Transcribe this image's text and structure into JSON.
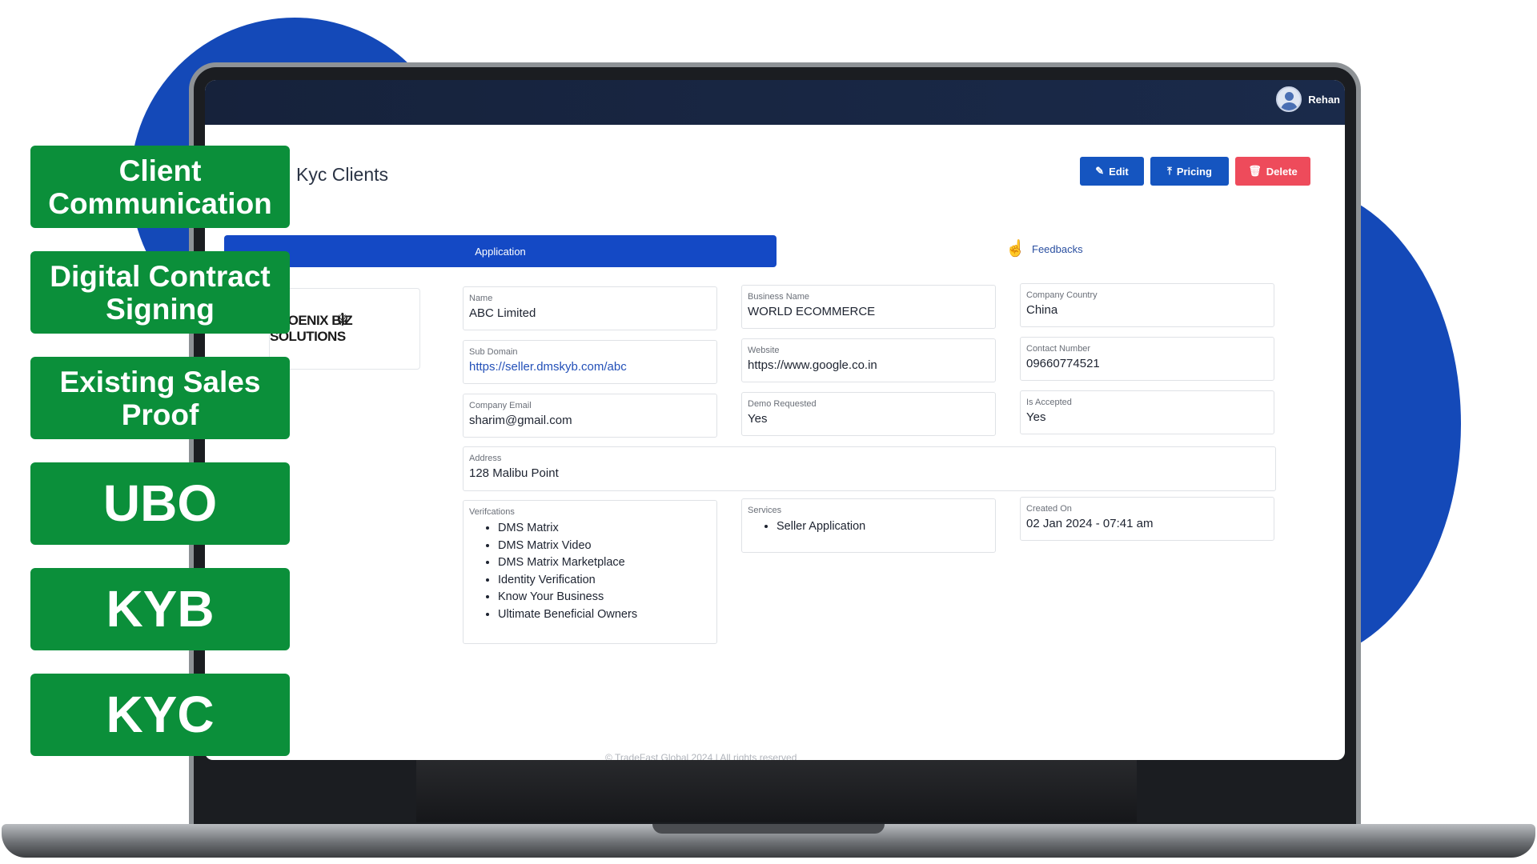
{
  "header": {
    "user_name": "Rehan"
  },
  "page": {
    "title": "Kyc Clients",
    "buttons": {
      "edit": "Edit",
      "pricing": "Pricing",
      "delete": "Delete"
    },
    "tabs": {
      "application": "Application",
      "feedbacks": "Feedbacks"
    },
    "logo_text": "PHOENIX BIZ SOLUTIONS"
  },
  "fields": {
    "name": {
      "label": "Name",
      "value": "ABC Limited"
    },
    "business_name": {
      "label": "Business Name",
      "value": "WORLD ECOMMERCE"
    },
    "company_country": {
      "label": "Company Country",
      "value": "China"
    },
    "sub_domain": {
      "label": "Sub Domain",
      "value": "https://seller.dmskyb.com/abc"
    },
    "website": {
      "label": "Website",
      "value": "https://www.google.co.in"
    },
    "contact_number": {
      "label": "Contact Number",
      "value": "09660774521"
    },
    "company_email": {
      "label": "Company Email",
      "value": "sharim@gmail.com"
    },
    "demo_requested": {
      "label": "Demo Requested",
      "value": "Yes"
    },
    "is_accepted": {
      "label": "Is Accepted",
      "value": "Yes"
    },
    "address": {
      "label": "Address",
      "value": "128 Malibu Point"
    },
    "verifications": {
      "label": "Verifcations",
      "items": [
        "DMS Matrix",
        "DMS Matrix Video",
        "DMS Matrix Marketplace",
        "Identity Verification",
        "Know Your Business",
        "Ultimate Beneficial Owners"
      ]
    },
    "services": {
      "label": "Services",
      "items": [
        "Seller Application"
      ]
    },
    "created_on": {
      "label": "Created On",
      "value": "02 Jan 2024 - 07:41 am"
    }
  },
  "footer": "© TradeFast Global 2024 | All rights reserved",
  "badges": [
    "Client Communication",
    "Digital Contract Signing",
    "Existing Sales Proof",
    "UBO",
    "KYB",
    "KYC"
  ],
  "colors": {
    "brand_blue": "#1449c5",
    "delete_red": "#ee4b5b",
    "badge_green": "#0b8f3a"
  }
}
